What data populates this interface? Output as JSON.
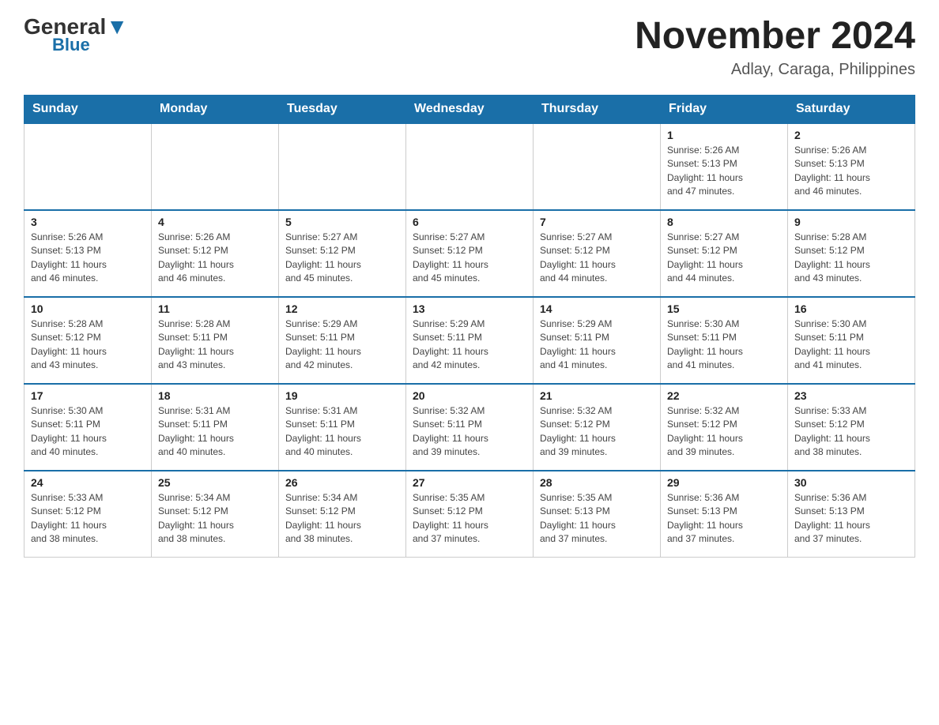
{
  "header": {
    "logo_general": "General",
    "logo_blue": "Blue",
    "month_title": "November 2024",
    "location": "Adlay, Caraga, Philippines"
  },
  "days_of_week": [
    "Sunday",
    "Monday",
    "Tuesday",
    "Wednesday",
    "Thursday",
    "Friday",
    "Saturday"
  ],
  "weeks": [
    {
      "days": [
        {
          "num": "",
          "info": ""
        },
        {
          "num": "",
          "info": ""
        },
        {
          "num": "",
          "info": ""
        },
        {
          "num": "",
          "info": ""
        },
        {
          "num": "",
          "info": ""
        },
        {
          "num": "1",
          "info": "Sunrise: 5:26 AM\nSunset: 5:13 PM\nDaylight: 11 hours\nand 47 minutes."
        },
        {
          "num": "2",
          "info": "Sunrise: 5:26 AM\nSunset: 5:13 PM\nDaylight: 11 hours\nand 46 minutes."
        }
      ]
    },
    {
      "days": [
        {
          "num": "3",
          "info": "Sunrise: 5:26 AM\nSunset: 5:13 PM\nDaylight: 11 hours\nand 46 minutes."
        },
        {
          "num": "4",
          "info": "Sunrise: 5:26 AM\nSunset: 5:12 PM\nDaylight: 11 hours\nand 46 minutes."
        },
        {
          "num": "5",
          "info": "Sunrise: 5:27 AM\nSunset: 5:12 PM\nDaylight: 11 hours\nand 45 minutes."
        },
        {
          "num": "6",
          "info": "Sunrise: 5:27 AM\nSunset: 5:12 PM\nDaylight: 11 hours\nand 45 minutes."
        },
        {
          "num": "7",
          "info": "Sunrise: 5:27 AM\nSunset: 5:12 PM\nDaylight: 11 hours\nand 44 minutes."
        },
        {
          "num": "8",
          "info": "Sunrise: 5:27 AM\nSunset: 5:12 PM\nDaylight: 11 hours\nand 44 minutes."
        },
        {
          "num": "9",
          "info": "Sunrise: 5:28 AM\nSunset: 5:12 PM\nDaylight: 11 hours\nand 43 minutes."
        }
      ]
    },
    {
      "days": [
        {
          "num": "10",
          "info": "Sunrise: 5:28 AM\nSunset: 5:12 PM\nDaylight: 11 hours\nand 43 minutes."
        },
        {
          "num": "11",
          "info": "Sunrise: 5:28 AM\nSunset: 5:11 PM\nDaylight: 11 hours\nand 43 minutes."
        },
        {
          "num": "12",
          "info": "Sunrise: 5:29 AM\nSunset: 5:11 PM\nDaylight: 11 hours\nand 42 minutes."
        },
        {
          "num": "13",
          "info": "Sunrise: 5:29 AM\nSunset: 5:11 PM\nDaylight: 11 hours\nand 42 minutes."
        },
        {
          "num": "14",
          "info": "Sunrise: 5:29 AM\nSunset: 5:11 PM\nDaylight: 11 hours\nand 41 minutes."
        },
        {
          "num": "15",
          "info": "Sunrise: 5:30 AM\nSunset: 5:11 PM\nDaylight: 11 hours\nand 41 minutes."
        },
        {
          "num": "16",
          "info": "Sunrise: 5:30 AM\nSunset: 5:11 PM\nDaylight: 11 hours\nand 41 minutes."
        }
      ]
    },
    {
      "days": [
        {
          "num": "17",
          "info": "Sunrise: 5:30 AM\nSunset: 5:11 PM\nDaylight: 11 hours\nand 40 minutes."
        },
        {
          "num": "18",
          "info": "Sunrise: 5:31 AM\nSunset: 5:11 PM\nDaylight: 11 hours\nand 40 minutes."
        },
        {
          "num": "19",
          "info": "Sunrise: 5:31 AM\nSunset: 5:11 PM\nDaylight: 11 hours\nand 40 minutes."
        },
        {
          "num": "20",
          "info": "Sunrise: 5:32 AM\nSunset: 5:11 PM\nDaylight: 11 hours\nand 39 minutes."
        },
        {
          "num": "21",
          "info": "Sunrise: 5:32 AM\nSunset: 5:12 PM\nDaylight: 11 hours\nand 39 minutes."
        },
        {
          "num": "22",
          "info": "Sunrise: 5:32 AM\nSunset: 5:12 PM\nDaylight: 11 hours\nand 39 minutes."
        },
        {
          "num": "23",
          "info": "Sunrise: 5:33 AM\nSunset: 5:12 PM\nDaylight: 11 hours\nand 38 minutes."
        }
      ]
    },
    {
      "days": [
        {
          "num": "24",
          "info": "Sunrise: 5:33 AM\nSunset: 5:12 PM\nDaylight: 11 hours\nand 38 minutes."
        },
        {
          "num": "25",
          "info": "Sunrise: 5:34 AM\nSunset: 5:12 PM\nDaylight: 11 hours\nand 38 minutes."
        },
        {
          "num": "26",
          "info": "Sunrise: 5:34 AM\nSunset: 5:12 PM\nDaylight: 11 hours\nand 38 minutes."
        },
        {
          "num": "27",
          "info": "Sunrise: 5:35 AM\nSunset: 5:12 PM\nDaylight: 11 hours\nand 37 minutes."
        },
        {
          "num": "28",
          "info": "Sunrise: 5:35 AM\nSunset: 5:13 PM\nDaylight: 11 hours\nand 37 minutes."
        },
        {
          "num": "29",
          "info": "Sunrise: 5:36 AM\nSunset: 5:13 PM\nDaylight: 11 hours\nand 37 minutes."
        },
        {
          "num": "30",
          "info": "Sunrise: 5:36 AM\nSunset: 5:13 PM\nDaylight: 11 hours\nand 37 minutes."
        }
      ]
    }
  ]
}
